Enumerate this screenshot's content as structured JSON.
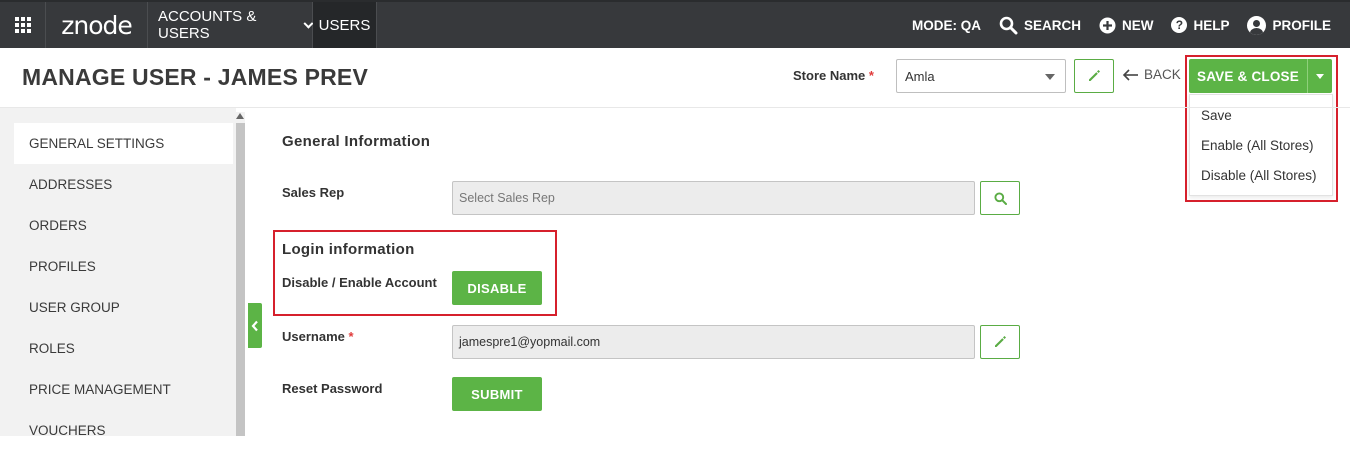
{
  "topnav": {
    "logo_text": "znode",
    "accounts_menu": "ACCOUNTS & USERS",
    "users_tab": "USERS",
    "mode": "MODE: QA",
    "search": "SEARCH",
    "new": "NEW",
    "help": "HELP",
    "profile": "PROFILE"
  },
  "header": {
    "title": "MANAGE USER - JAMES PREV",
    "store_label": "Store Name",
    "required_mark": "*",
    "store_value": "Amla",
    "back": "BACK",
    "save_close": "SAVE & CLOSE",
    "dropdown_items": [
      "Save",
      "Enable (All Stores)",
      "Disable (All Stores)"
    ]
  },
  "sidebar": {
    "items": [
      "GENERAL SETTINGS",
      "ADDRESSES",
      "ORDERS",
      "PROFILES",
      "USER GROUP",
      "ROLES",
      "PRICE MANAGEMENT",
      "VOUCHERS"
    ],
    "active_index": 0
  },
  "main": {
    "general_info_title": "General Information",
    "sales_rep_label": "Sales Rep",
    "sales_rep_placeholder": "Select Sales Rep",
    "login_info_title": "Login information",
    "account_toggle_label": "Disable / Enable Account",
    "disable_button": "DISABLE",
    "username_label": "Username",
    "username_required": "*",
    "username_value": "jamespre1@yopmail.com",
    "reset_password_label": "Reset Password",
    "submit_button": "SUBMIT"
  },
  "colors": {
    "nav_bg": "#37393c",
    "accent_green": "#5cb446",
    "highlight_red": "#d6202c"
  },
  "icons": {
    "apps": "apps-grid-icon",
    "search": "search-icon",
    "new": "plus-circle-icon",
    "help": "help-circle-icon",
    "profile": "user-circle-icon",
    "edit": "pencil-icon",
    "back": "arrow-left-icon",
    "collapse": "chevron-left-icon"
  }
}
